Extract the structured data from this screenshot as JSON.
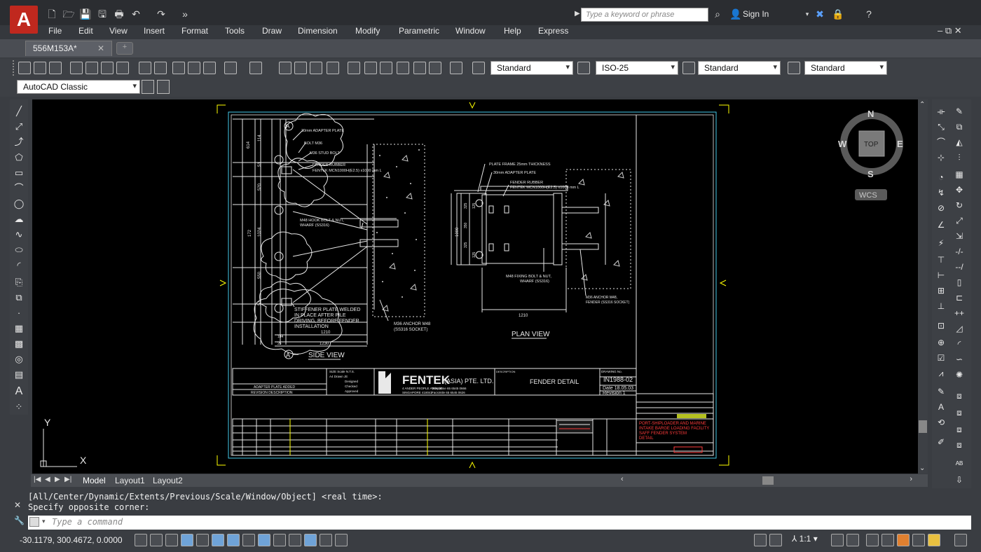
{
  "app": {
    "logo_letter": "A",
    "search_placeholder": "Type a keyword or phrase",
    "signin_label": "Sign In"
  },
  "menu": [
    "File",
    "Edit",
    "View",
    "Insert",
    "Format",
    "Tools",
    "Draw",
    "Dimension",
    "Modify",
    "Parametric",
    "Window",
    "Help",
    "Express"
  ],
  "tabs": {
    "document": "556M153A*"
  },
  "toolbar": {
    "text_style": "Standard",
    "dim_style": "ISO-25",
    "table_style": "Standard",
    "multileader_style": "Standard",
    "workspace": "AutoCAD Classic"
  },
  "viewcube": {
    "n": "N",
    "s": "S",
    "e": "E",
    "w": "W",
    "top": "TOP",
    "ucs": "WCS"
  },
  "ucs": {
    "x": "X",
    "y": "Y"
  },
  "drawing": {
    "side_view_title": "SIDE VIEW",
    "plan_view_title": "PLAN VIEW",
    "section_marker": "A",
    "labels": {
      "adapter_plate": "30mm ADAPTER PLATE",
      "bolt": "BOLT M36",
      "stud_bolt": "M36 STUD BOLT",
      "fender_rubber": "FENDER RUBBER",
      "fender_rubber_spec": "FENTEK MCN1000H(E2.5) x1000 mm L",
      "hook_bolt": "M48 HOOK BOLT & NUT,",
      "hook_bolt_2": "WHARF (SS316)",
      "stiffener_1": "STIFFENER PLATE WELDED",
      "stiffener_2": "IN PLACE AFTER PILE",
      "stiffener_3": "DRIVING, BEFORE FENDER",
      "stiffener_4": "INSTALLATION",
      "anchor": "M36 ANCHOR M48",
      "anchor_2": "(SS316 SOCKET)",
      "plate_frame": "PLATE FRAME 25mm THICKNESS",
      "adapter_plan": "30mm ADAPTER PLATE",
      "fender_plan": "FENDER RUBBER",
      "fender_plan_2": "FENTEK MCN1000H(E2.5) x1000 mm L",
      "fixing_bolt": "M48 FIXING BOLT & NUT,",
      "fixing_bolt_2": "WHARF (SS316)",
      "anchor_plan": "M36 ANCHOR M48,",
      "anchor_plan_2": "FENDER (SS316 SOCKET)"
    },
    "dims": {
      "d1210": "1210",
      "d1230": "1230",
      "d1000": "1000",
      "d1210b": "1210"
    },
    "titleblock": {
      "company": "FENTEK",
      "company_sub": "(ASIA) PTE. LTD.",
      "description_label": "DESCRIPTION",
      "description": "FENDER DETAIL",
      "drawing_no_label": "DRAWING No.",
      "drawing_no": "IN1988-02",
      "date": "Date  18.05.03",
      "revision": "Revision  1",
      "rev_row": "ADAPTER PLATE ADDED",
      "rev_header": "REVISION DESCRIPTION",
      "project_1": "PORT-SHIPLOADER AND MARINE",
      "project_2": "INTAKE BARGE LOADING FACILITY",
      "project_3": "SAFF FENDER SYSTEM",
      "project_4": "DETAIL"
    }
  },
  "layout_tabs": [
    "Model",
    "Layout1",
    "Layout2"
  ],
  "command": {
    "line1": "[All/Center/Dynamic/Extents/Previous/Scale/Window/Object] <real time>:",
    "line2": "Specify opposite corner:",
    "placeholder": "Type a command"
  },
  "status": {
    "coordinates": "-30.1179, 300.4672, 0.0000",
    "scale": "1:1"
  },
  "colors": {
    "canvas": "#000000",
    "paper_border": "#ffff00",
    "frame": "#44c8e8",
    "red_text": "#ff3b3b",
    "app_red": "#c0281e"
  }
}
